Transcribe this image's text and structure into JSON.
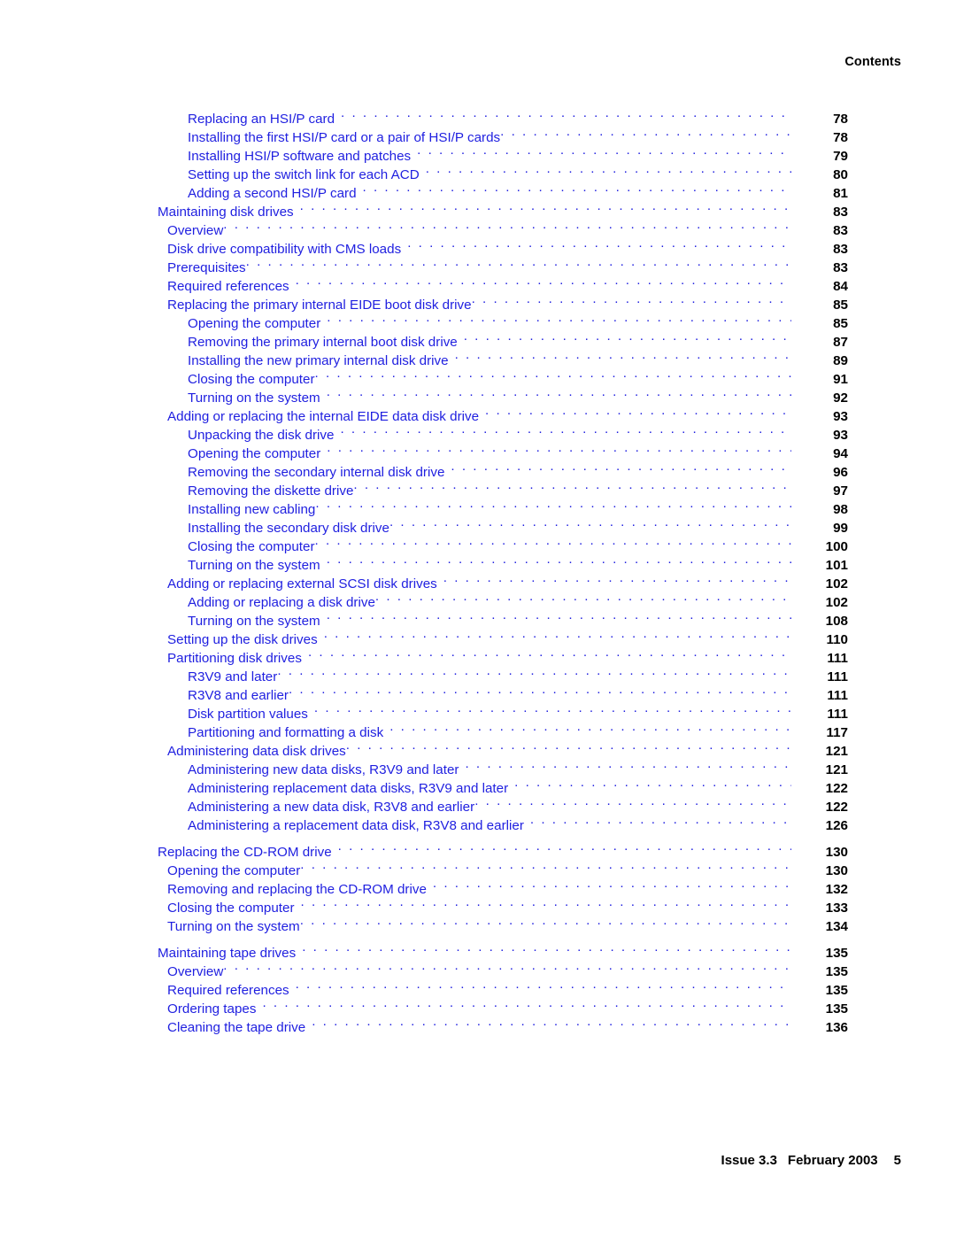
{
  "header": {
    "running_head": "Contents"
  },
  "footer": {
    "issue": "Issue 3.3",
    "date": "February 2003",
    "folio": "5"
  },
  "toc": {
    "entries": [
      {
        "level": 3,
        "title": "Replacing an HSI/P card",
        "page": "78",
        "space_after_title": true,
        "gap_before": false
      },
      {
        "level": 3,
        "title": "Installing the first HSI/P card or a pair of HSI/P cards",
        "page": "78",
        "space_after_title": false,
        "gap_before": false
      },
      {
        "level": 3,
        "title": "Installing HSI/P software and patches",
        "page": "79",
        "space_after_title": true,
        "gap_before": false
      },
      {
        "level": 3,
        "title": "Setting up the switch link for each ACD",
        "page": "80",
        "space_after_title": true,
        "gap_before": false
      },
      {
        "level": 3,
        "title": "Adding a second HSI/P card",
        "page": "81",
        "space_after_title": true,
        "gap_before": false
      },
      {
        "level": 1,
        "title": "Maintaining disk drives",
        "page": "83",
        "space_after_title": true,
        "gap_before": false
      },
      {
        "level": 2,
        "title": "Overview",
        "page": "83",
        "space_after_title": false,
        "gap_before": false
      },
      {
        "level": 2,
        "title": "Disk drive compatibility with CMS loads",
        "page": "83",
        "space_after_title": true,
        "gap_before": false
      },
      {
        "level": 2,
        "title": "Prerequisites",
        "page": "83",
        "space_after_title": false,
        "gap_before": false
      },
      {
        "level": 2,
        "title": "Required references",
        "page": "84",
        "space_after_title": true,
        "gap_before": false
      },
      {
        "level": 2,
        "title": "Replacing the primary internal EIDE boot disk drive",
        "page": "85",
        "space_after_title": false,
        "gap_before": false
      },
      {
        "level": 3,
        "title": "Opening the computer",
        "page": "85",
        "space_after_title": true,
        "gap_before": false
      },
      {
        "level": 3,
        "title": "Removing the primary internal boot disk drive",
        "page": "87",
        "space_after_title": true,
        "gap_before": false
      },
      {
        "level": 3,
        "title": "Installing the new primary internal disk drive",
        "page": "89",
        "space_after_title": true,
        "gap_before": false
      },
      {
        "level": 3,
        "title": "Closing the computer",
        "page": "91",
        "space_after_title": false,
        "gap_before": false
      },
      {
        "level": 3,
        "title": "Turning on the system",
        "page": "92",
        "space_after_title": true,
        "gap_before": false
      },
      {
        "level": 2,
        "title": "Adding or replacing the internal EIDE data disk drive",
        "page": "93",
        "space_after_title": true,
        "gap_before": false
      },
      {
        "level": 3,
        "title": "Unpacking the disk drive",
        "page": "93",
        "space_after_title": true,
        "gap_before": false
      },
      {
        "level": 3,
        "title": "Opening the computer",
        "page": "94",
        "space_after_title": true,
        "gap_before": false
      },
      {
        "level": 3,
        "title": "Removing the secondary internal disk drive",
        "page": "96",
        "space_after_title": true,
        "gap_before": false
      },
      {
        "level": 3,
        "title": "Removing the diskette drive",
        "page": "97",
        "space_after_title": false,
        "gap_before": false
      },
      {
        "level": 3,
        "title": "Installing new cabling",
        "page": "98",
        "space_after_title": false,
        "gap_before": false
      },
      {
        "level": 3,
        "title": "Installing the secondary disk drive",
        "page": "99",
        "space_after_title": false,
        "gap_before": false
      },
      {
        "level": 3,
        "title": "Closing the computer",
        "page": "100",
        "space_after_title": false,
        "gap_before": false
      },
      {
        "level": 3,
        "title": "Turning on the system",
        "page": "101",
        "space_after_title": true,
        "gap_before": false
      },
      {
        "level": 2,
        "title": "Adding or replacing external SCSI disk drives",
        "page": "102",
        "space_after_title": true,
        "gap_before": false
      },
      {
        "level": 3,
        "title": "Adding or replacing a disk drive",
        "page": "102",
        "space_after_title": false,
        "gap_before": false
      },
      {
        "level": 3,
        "title": "Turning on the system",
        "page": "108",
        "space_after_title": true,
        "gap_before": false
      },
      {
        "level": 2,
        "title": "Setting up the disk drives",
        "page": "110",
        "space_after_title": true,
        "gap_before": false
      },
      {
        "level": 2,
        "title": "Partitioning disk drives",
        "page": "111",
        "space_after_title": true,
        "gap_before": false
      },
      {
        "level": 3,
        "title": "R3V9 and later",
        "page": "111",
        "space_after_title": false,
        "gap_before": false
      },
      {
        "level": 3,
        "title": "R3V8 and earlier",
        "page": "111",
        "space_after_title": false,
        "gap_before": false
      },
      {
        "level": 3,
        "title": "Disk partition values",
        "page": "111",
        "space_after_title": true,
        "gap_before": false
      },
      {
        "level": 3,
        "title": "Partitioning and formatting a disk",
        "page": "117",
        "space_after_title": true,
        "gap_before": false
      },
      {
        "level": 2,
        "title": "Administering data disk drives",
        "page": "121",
        "space_after_title": false,
        "gap_before": false
      },
      {
        "level": 3,
        "title": "Administering new data disks, R3V9 and later",
        "page": "121",
        "space_after_title": true,
        "gap_before": false
      },
      {
        "level": 3,
        "title": "Administering replacement data disks, R3V9 and later",
        "page": "122",
        "space_after_title": true,
        "gap_before": false
      },
      {
        "level": 3,
        "title": "Administering a new data disk, R3V8 and earlier",
        "page": "122",
        "space_after_title": false,
        "gap_before": false
      },
      {
        "level": 3,
        "title": "Administering a replacement data disk, R3V8 and earlier",
        "page": "126",
        "space_after_title": true,
        "gap_before": false
      },
      {
        "level": 1,
        "title": "Replacing the CD-ROM drive",
        "page": "130",
        "space_after_title": true,
        "gap_before": true
      },
      {
        "level": 2,
        "title": "Opening the computer",
        "page": "130",
        "space_after_title": false,
        "gap_before": false
      },
      {
        "level": 2,
        "title": "Removing and replacing the CD-ROM drive",
        "page": "132",
        "space_after_title": true,
        "gap_before": false
      },
      {
        "level": 2,
        "title": "Closing the computer",
        "page": "133",
        "space_after_title": true,
        "gap_before": false
      },
      {
        "level": 2,
        "title": "Turning on the system",
        "page": "134",
        "space_after_title": false,
        "gap_before": false
      },
      {
        "level": 1,
        "title": "Maintaining tape drives",
        "page": "135",
        "space_after_title": true,
        "gap_before": true
      },
      {
        "level": 2,
        "title": "Overview",
        "page": "135",
        "space_after_title": false,
        "gap_before": false
      },
      {
        "level": 2,
        "title": "Required references",
        "page": "135",
        "space_after_title": true,
        "gap_before": false
      },
      {
        "level": 2,
        "title": "Ordering tapes",
        "page": "135",
        "space_after_title": true,
        "gap_before": false
      },
      {
        "level": 2,
        "title": "Cleaning the tape drive",
        "page": "136",
        "space_after_title": true,
        "gap_before": false
      }
    ]
  },
  "colors": {
    "entry_blue": "#1f1fe0",
    "page_number_black": "#000000",
    "background": "#ffffff"
  }
}
